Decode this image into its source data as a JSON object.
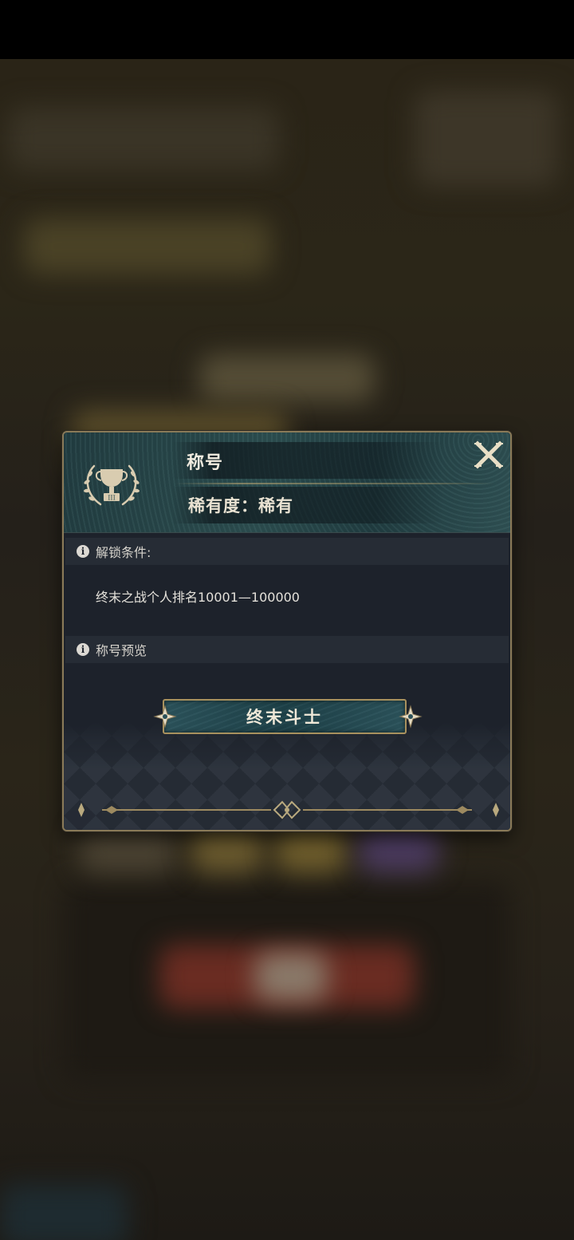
{
  "modal": {
    "title": "称号",
    "rarity_label": "稀有度：",
    "rarity_value": "稀有",
    "close_label": "X"
  },
  "unlock": {
    "heading": "解锁条件:",
    "condition": "终末之战个人排名10001—100000"
  },
  "preview": {
    "heading": "称号预览",
    "title_name": "终末斗士"
  },
  "icons": {
    "trophy": "trophy-laurel-icon",
    "info": "info-icon",
    "close": "close-icon"
  },
  "colors": {
    "accent_gold": "#a8915e",
    "header_teal": "#2a4a4c",
    "panel_bg": "#1d222b"
  }
}
